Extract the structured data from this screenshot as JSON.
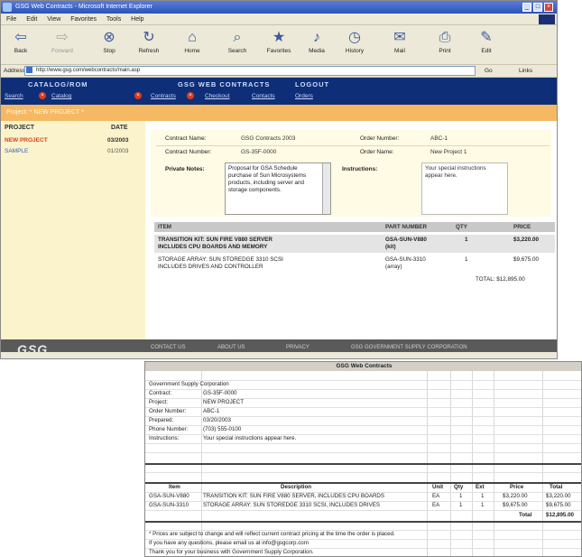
{
  "window": {
    "title": "GSG Web Contracts - Microsoft Internet Explorer",
    "minimize": "_",
    "maximize": "□",
    "close": "×"
  },
  "menu": [
    "File",
    "Edit",
    "View",
    "Favorites",
    "Tools",
    "Help"
  ],
  "toolbar": [
    {
      "label": "Back",
      "icon": "back-arrow-icon",
      "glyph": "⇦"
    },
    {
      "label": "Forward",
      "icon": "forward-arrow-icon",
      "glyph": "⇨"
    },
    {
      "label": "Stop",
      "icon": "stop-icon",
      "glyph": "⊗"
    },
    {
      "label": "Refresh",
      "icon": "refresh-icon",
      "glyph": "↻"
    },
    {
      "label": "Home",
      "icon": "home-icon",
      "glyph": "⌂"
    },
    {
      "label": "Search",
      "icon": "search-icon",
      "glyph": "⌕"
    },
    {
      "label": "Favorites",
      "icon": "favorites-icon",
      "glyph": "★"
    },
    {
      "label": "Media",
      "icon": "media-icon",
      "glyph": "♪"
    },
    {
      "label": "History",
      "icon": "history-icon",
      "glyph": "◷"
    },
    {
      "label": "Mail",
      "icon": "mail-icon",
      "glyph": "✉"
    },
    {
      "label": "Print",
      "icon": "print-icon",
      "glyph": "⎙"
    },
    {
      "label": "Edit",
      "icon": "edit-icon",
      "glyph": "✎"
    }
  ],
  "address": {
    "label": "Address",
    "url": "http://www.gsg.com/webcontracts/main.asp",
    "go": "Go",
    "links": "Links"
  },
  "site_nav": {
    "catalog": "CATALOG/ROM",
    "contracts": "GSG WEB CONTRACTS",
    "logout": "LOGOUT",
    "catalog_links": [
      "Search",
      "Catalog"
    ],
    "contracts_links": [
      "Contracts",
      "Checkout",
      "Contacts",
      "Orders"
    ]
  },
  "project_bar": "Project: * NEW PROJECT *",
  "left": {
    "col_project": "PROJECT",
    "col_date": "DATE",
    "rows": [
      {
        "project": "NEW PROJECT",
        "date": "03/2003"
      },
      {
        "project": "SAMPLE",
        "date": "01/2003"
      }
    ]
  },
  "form": {
    "contract_label": "Contract Name:",
    "contract_value": "GSG Contracts 2003",
    "contract_number_label": "Contract Number:",
    "contract_number_value": "GS-35F-0000",
    "order_number_label": "Order Number:",
    "order_number_value": "ABC-1",
    "order_name_label": "Order Name:",
    "order_name_value": "New Project 1",
    "notes_label": "Private Notes:",
    "notes_text": "Proposal for GSA Schedule purchase of Sun Microsystems products, including server and storage components.",
    "instructions_label": "Instructions:",
    "instructions_text": "Your special instructions appear here."
  },
  "items": {
    "headers": [
      "ITEM",
      "PART NUMBER",
      "QTY",
      "PRICE"
    ],
    "rows": [
      {
        "item": "TRANSITION KIT: SUN FIRE V880 SERVER",
        "item2": "INCLUDES CPU BOARDS AND MEMORY",
        "part": "GSA-SUN-V880",
        "part2": "(kit)",
        "qty": "1",
        "price": "$3,220.00"
      },
      {
        "item": "STORAGE ARRAY: SUN STOREDGE 3310 SCSI",
        "item2": "INCLUDES DRIVES AND CONTROLLER",
        "part": "GSA-SUN-3310",
        "part2": "(array)",
        "qty": "1",
        "price": "$9,675.00"
      }
    ],
    "total": "TOTAL: $12,895.00"
  },
  "footer": {
    "logo": "GSG",
    "links": [
      "CONTACT US",
      "ABOUT US",
      "PRIVACY",
      "GSG GOVERNMENT SUPPLY CORPORATION"
    ]
  },
  "sheet": {
    "title": "GSG Web Contracts",
    "company": "Government Supply Corporation",
    "info": [
      {
        "k": "Contract:",
        "v": "GS-35F-0000"
      },
      {
        "k": "Project:",
        "v": "NEW PROJECT"
      },
      {
        "k": "Order Number:",
        "v": "ABC-1"
      },
      {
        "k": "Prepared:",
        "v": "03/20/2003"
      },
      {
        "k": "Phone Number:",
        "v": "(703) 555-0100"
      },
      {
        "k": "Instructions:",
        "v": "Your special instructions appear here."
      }
    ],
    "headers": [
      "Item",
      "Description",
      "Unit",
      "Qty",
      "Ext",
      "Price",
      "Total"
    ],
    "rows": [
      {
        "item": "GSA-SUN-V880",
        "desc": "TRANSITION KIT: SUN FIRE V880 SERVER, INCLUDES CPU BOARDS",
        "unit": "EA",
        "qty": "1",
        "ext": "1",
        "price": "$3,220.00",
        "total": "$3,220.00"
      },
      {
        "item": "GSA-SUN-3310",
        "desc": "STORAGE ARRAY: SUN STOREDGE 3310 SCSI, INCLUDES DRIVES",
        "unit": "EA",
        "qty": "1",
        "ext": "1",
        "price": "$9,675.00",
        "total": "$9,675.00"
      }
    ],
    "total_label": "Total",
    "total_value": "$12,895.00",
    "notes": [
      "* Prices are subject to change and will reflect current contract pricing at the time the order is placed.",
      "If you have any questions, please email us at info@gsgcorp.com",
      "Thank you for your business with Government Supply Corporation."
    ]
  }
}
